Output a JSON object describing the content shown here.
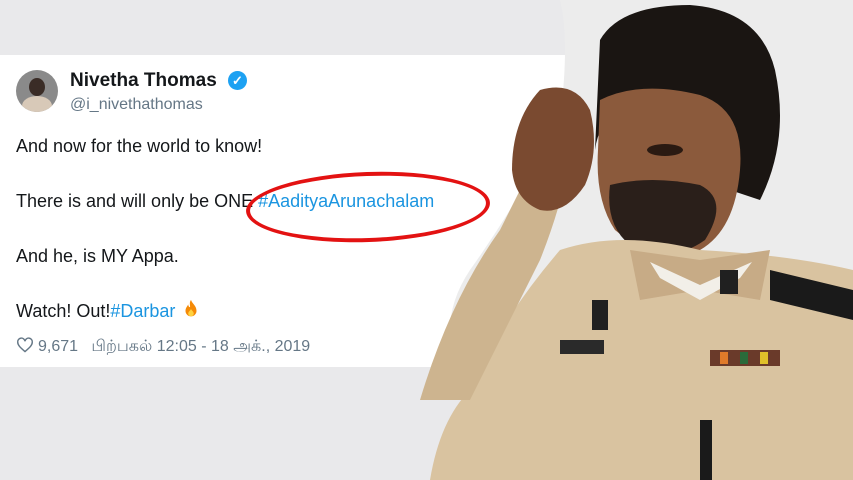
{
  "tweet": {
    "name": "Nivetha Thomas",
    "handle": "@i_nivethathomas",
    "line1": "And now for the world to know!",
    "line2_prefix": "There is and will only be ONE ",
    "hashtag1": "#AadityaArunachalam",
    "line3": "And he, is MY Appa.",
    "line4_prefix": "Watch! Out!",
    "hashtag2": "#Darbar",
    "likes": "9,671",
    "timestamp": "பிற்பகல் 12:05 - 18 அக்., 2019"
  },
  "colors": {
    "hashtag": "#1b95e0",
    "verified": "#1da1f2",
    "highlight_circle": "#e31212"
  },
  "icons": [
    "verified-badge-icon",
    "fire-emoji-icon",
    "heart-icon"
  ]
}
